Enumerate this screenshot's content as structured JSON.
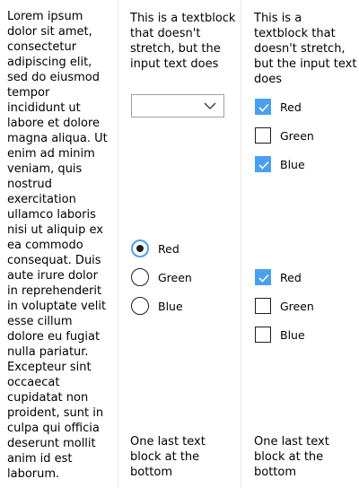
{
  "col1": {
    "lorem": "Lorem ipsum dolor sit amet, consectetur adipiscing elit, sed do eiusmod tempor incididunt ut labore et dolore magna aliqua. Ut enim ad minim veniam, quis nostrud exercitation ullamco laboris nisi ut aliquip ex ea commodo consequat. Duis aute irure dolor in reprehenderit in voluptate velit esse cillum dolore eu fugiat nulla pariatur. Excepteur sint occaecat cupidatat non proident, sunt in culpa qui officia deserunt mollit anim id est laborum."
  },
  "col2": {
    "header": "This is a textblock that doesn't stretch, but the input text does",
    "combo_value": "",
    "radios": [
      {
        "label": "Red",
        "checked": true
      },
      {
        "label": "Green",
        "checked": false
      },
      {
        "label": "Blue",
        "checked": false
      }
    ],
    "footer": "One last text block at the bottom"
  },
  "col3": {
    "header": "This is a textblock that doesn't stretch, but the input text does",
    "checks_top": [
      {
        "label": "Red",
        "checked": true
      },
      {
        "label": "Green",
        "checked": false
      },
      {
        "label": "Blue",
        "checked": true
      }
    ],
    "checks_bottom": [
      {
        "label": "Red",
        "checked": true
      },
      {
        "label": "Green",
        "checked": false
      },
      {
        "label": "Blue",
        "checked": false
      }
    ],
    "footer": "One last text block at the bottom"
  },
  "colors": {
    "accent": "#4a9ff0",
    "divider": "#e6e6e6"
  }
}
